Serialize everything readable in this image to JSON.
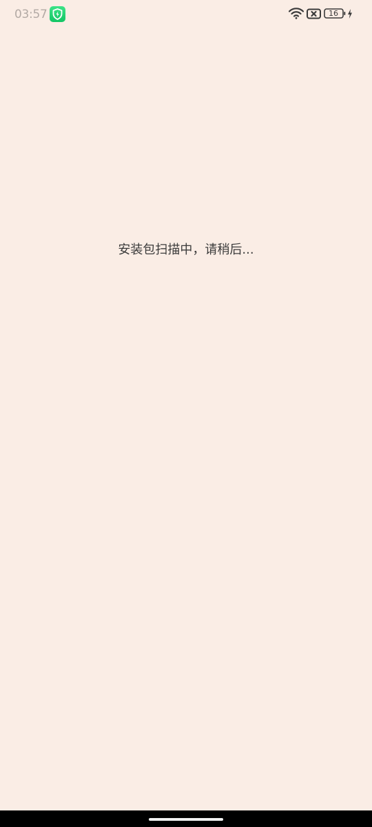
{
  "status_bar": {
    "time": "03:57",
    "battery_level": "16",
    "charging": true,
    "wifi": "connected",
    "sim": "no-sim",
    "notification_app_icon": "shield-icon",
    "accent_color": "#1fd174"
  },
  "main": {
    "message": "安装包扫描中，请稍后..."
  },
  "colors": {
    "background": "#faede5",
    "text": "#3b3b3b",
    "nav_bar": "#000000"
  }
}
